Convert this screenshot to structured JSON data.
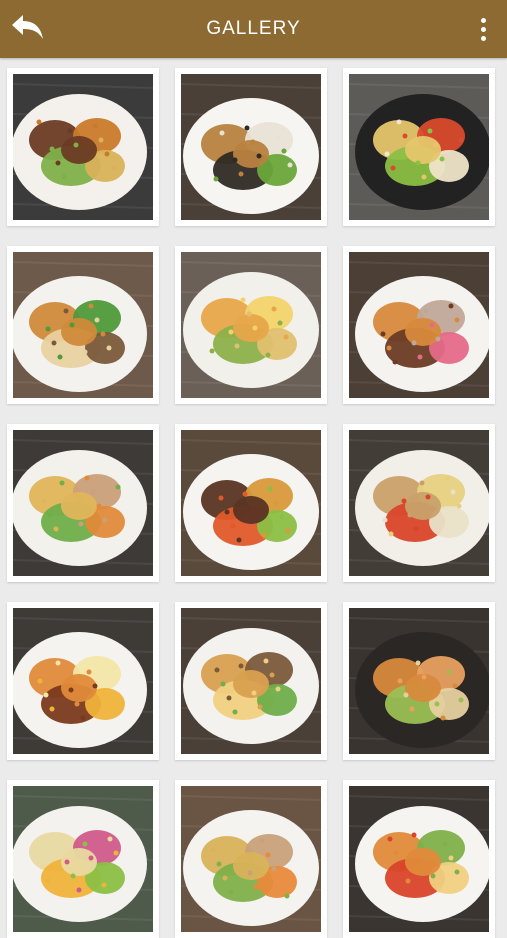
{
  "header": {
    "title": "GALLERY",
    "back_icon": "back-arrow-icon",
    "menu_icon": "more-vertical-icon",
    "bar_color": "#8c6a31"
  },
  "gallery": {
    "tiles": [
      {
        "id": "dish-1",
        "table": "#3b3b3b",
        "plate": "#f4f1ec",
        "food": [
          "#6b3b24",
          "#c97a2a",
          "#7fb04a",
          "#d9b25a"
        ]
      },
      {
        "id": "dish-2",
        "table": "#4a4038",
        "plate": "#f7f5f1",
        "food": [
          "#b8823f",
          "#e8e2d6",
          "#2f2a24",
          "#6aa63a"
        ]
      },
      {
        "id": "dish-3",
        "table": "#5d5b58",
        "plate": "#222222",
        "food": [
          "#e6c66b",
          "#d94b2d",
          "#8bbf45",
          "#efe5c9"
        ]
      },
      {
        "id": "dish-4",
        "table": "#6e5a4a",
        "plate": "#f4f2ee",
        "food": [
          "#d08a3a",
          "#4f9a3a",
          "#e9d1a0",
          "#7a5a3a"
        ]
      },
      {
        "id": "dish-5",
        "table": "#6b6058",
        "plate": "#f2f0eb",
        "food": [
          "#e7a64a",
          "#f2d36b",
          "#8db04a",
          "#e0c070"
        ]
      },
      {
        "id": "dish-6",
        "table": "#4b3f36",
        "plate": "#f5f3ef",
        "food": [
          "#d7893c",
          "#c0a898",
          "#6b3b24",
          "#e56a8a"
        ]
      },
      {
        "id": "dish-7",
        "table": "#3d3a37",
        "plate": "#f3f1ec",
        "food": [
          "#e0b55a",
          "#c9a07a",
          "#6fae4a",
          "#e08a3a"
        ]
      },
      {
        "id": "dish-8",
        "table": "#5a4a3c",
        "plate": "#f6f4f0",
        "food": [
          "#5a3424",
          "#d89a3a",
          "#e05a2a",
          "#8bbf45"
        ]
      },
      {
        "id": "dish-9",
        "table": "#433d38",
        "plate": "#f2efe9",
        "food": [
          "#c9a06a",
          "#e6d080",
          "#d9442a",
          "#e9e2c8"
        ]
      },
      {
        "id": "dish-10",
        "table": "#3e3a36",
        "plate": "#f5f3ef",
        "food": [
          "#e08a3a",
          "#f2e6a8",
          "#7a3a1e",
          "#f0b33a"
        ]
      },
      {
        "id": "dish-11",
        "table": "#4a4038",
        "plate": "#f4f2ee",
        "food": [
          "#d8a050",
          "#7a5a3a",
          "#f0d080",
          "#6fae4a"
        ]
      },
      {
        "id": "dish-12",
        "table": "#3a3430",
        "plate": "#2b2724",
        "food": [
          "#d7893c",
          "#e8a060",
          "#9bbf55",
          "#e6d0a0"
        ]
      },
      {
        "id": "dish-13",
        "table": "#4e5a4a",
        "plate": "#f4f2ee",
        "food": [
          "#e8d9a0",
          "#d05a8a",
          "#f0b33a",
          "#8bbf45"
        ]
      },
      {
        "id": "dish-14",
        "table": "#6a5444",
        "plate": "#f5f3ef",
        "food": [
          "#d9b25a",
          "#c9a07a",
          "#7fb04a",
          "#e88a3a"
        ]
      },
      {
        "id": "dish-15",
        "table": "#3a3530",
        "plate": "#f6f4f0",
        "food": [
          "#e08a3a",
          "#7fb04a",
          "#d9442a",
          "#f0d080"
        ]
      }
    ]
  }
}
